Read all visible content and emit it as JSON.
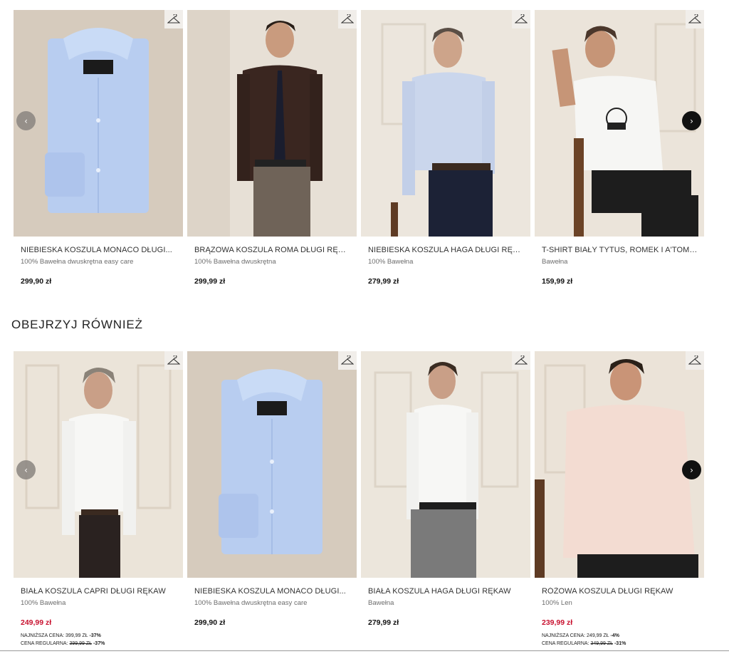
{
  "icons": {
    "hanger": "hanger-icon",
    "prev": "chevron-left-icon",
    "next": "chevron-right-icon"
  },
  "colors": {
    "sale": "#c8102e",
    "nav_next_bg": "#111111",
    "nav_prev_bg": "#8a8580"
  },
  "carousel_top": {
    "prev_label": "‹",
    "next_label": "›",
    "products": [
      {
        "title": "NIEBIESKA KOSZULA MONACO DŁUGI...",
        "material": "100% Bawełna dwuskrętna easy care",
        "price": "299,90 zł"
      },
      {
        "title": "BRĄZOWA KOSZULA ROMA DŁUGI RĘKAW",
        "material": "100% Bawełna dwuskrętna",
        "price": "299,99 zł"
      },
      {
        "title": "NIEBIESKA KOSZULA HAGA DŁUGI RĘKAW",
        "material": "100% Bawełna",
        "price": "279,99 zł"
      },
      {
        "title": "T-SHIRT BIAŁY TYTUS, ROMEK I A'TOMEK",
        "material": "Bawełna",
        "price": "159,99 zł"
      }
    ]
  },
  "section": {
    "heading": "OBEJRZYJ RÓWNIEŻ"
  },
  "carousel_bottom": {
    "prev_label": "‹",
    "next_label": "›",
    "products": [
      {
        "title": "BIAŁA KOSZULA CAPRI DŁUGI RĘKAW",
        "material": "100% Bawełna",
        "price": "249,99 zł",
        "lowest_label": "NAJNIŻSZA CENA:",
        "lowest_value": "399,99 ZŁ",
        "lowest_discount": "-37%",
        "regular_label": "CENA REGULARNA:",
        "regular_value": "399,99 ZŁ",
        "regular_discount": "-37%"
      },
      {
        "title": "NIEBIESKA KOSZULA MONACO DŁUGI...",
        "material": "100% Bawełna dwuskrętna easy care",
        "price": "299,90 zł"
      },
      {
        "title": "BIAŁA KOSZULA HAGA DŁUGI RĘKAW",
        "material": "Bawełna",
        "price": "279,99 zł"
      },
      {
        "title": "RÓŻOWA KOSZULA DŁUGI RĘKAW",
        "material": "100% Len",
        "price": "239,99 zł",
        "lowest_label": "NAJNIŻSZA CENA:",
        "lowest_value": "249,99 ZŁ",
        "lowest_discount": "-4%",
        "regular_label": "CENA REGULARNA:",
        "regular_value": "349,99 ZŁ",
        "regular_discount": "-31%"
      }
    ]
  }
}
